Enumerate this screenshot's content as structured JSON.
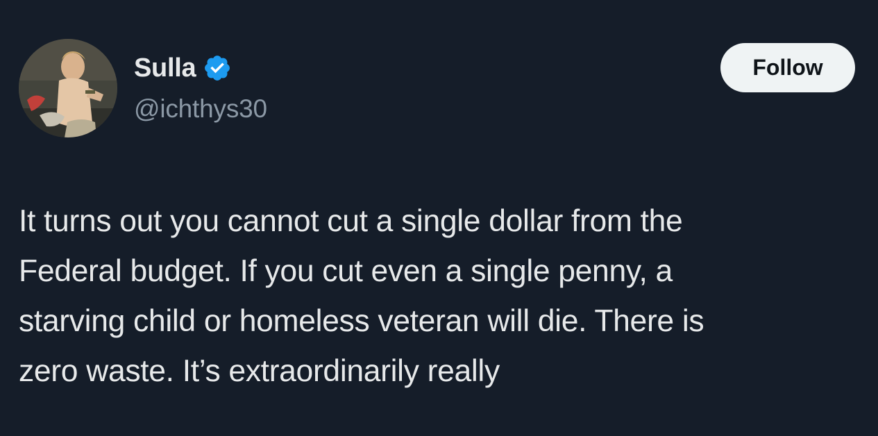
{
  "author": {
    "display_name": "Sulla",
    "handle": "@ichthys30",
    "verified": true,
    "verified_icon": "verified-badge-icon",
    "avatar": "avatar-painting"
  },
  "actions": {
    "follow_label": "Follow"
  },
  "tweet": {
    "lines": [
      "It turns out you cannot cut a single dollar from the",
      "Federal budget. If you cut even a single penny, a",
      "starving child or homeless veteran will die. There is",
      "zero waste. It’s extraordinarily really"
    ]
  },
  "colors": {
    "background": "#151d29",
    "text": "#e7e9ea",
    "secondary_text": "#8b98a5",
    "verified_blue": "#1d9bf0",
    "follow_bg": "#eff3f4"
  }
}
